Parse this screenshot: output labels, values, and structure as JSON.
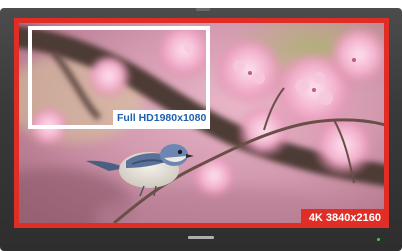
{
  "labels": {
    "full_hd": "Full HD1980x1080",
    "uhd_4k": "4K 3840x2160"
  },
  "colors": {
    "frame_4k": "#e02d26",
    "frame_full_hd": "#ffffff",
    "full_hd_text": "#1f5fae",
    "bezel": "#3a3a3a",
    "power_led": "#3bd14a"
  },
  "icons": {
    "brand_logo": "tv-brand-logo-icon",
    "power_indicator": "power-led-icon"
  }
}
